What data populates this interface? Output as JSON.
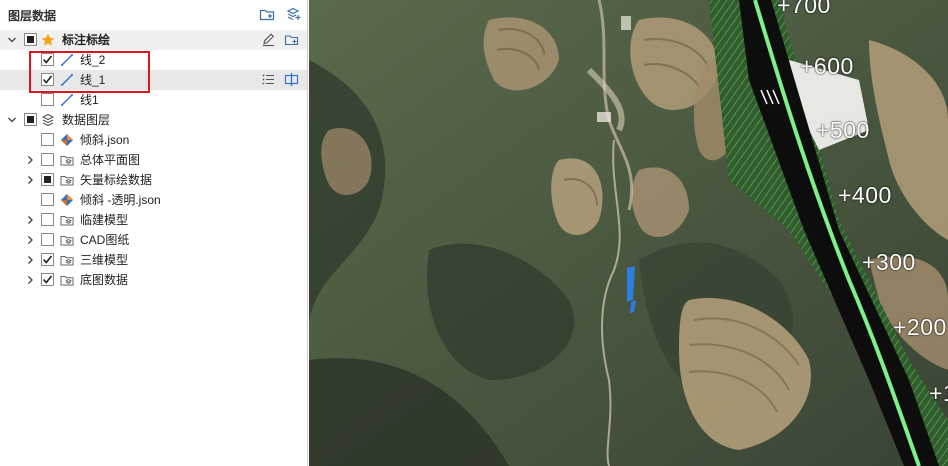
{
  "panel": {
    "title": "图层数据"
  },
  "layers": {
    "group_annotation": {
      "label": "标注标绘"
    },
    "line2": {
      "label": "线_2"
    },
    "line1_selected": {
      "label": "线_1"
    },
    "line1b": {
      "label": "线1"
    },
    "group_data": {
      "label": "数据图层"
    },
    "tilt_json": {
      "label": "倾斜.json"
    },
    "master_plan": {
      "label": "总体平面图"
    },
    "vector_plot": {
      "label": "矢量标绘数据"
    },
    "tilt_transparent": {
      "label": "倾斜 -透明.json"
    },
    "temp_model": {
      "label": "临建模型"
    },
    "cad_drawing": {
      "label": "CAD图纸"
    },
    "model_3d": {
      "label": "三维模型"
    },
    "basemap": {
      "label": "底图数据"
    }
  },
  "map": {
    "stations": [
      "+700",
      "+600",
      "+500",
      "+400",
      "+300",
      "+200",
      "+1"
    ]
  },
  "colors": {
    "accent": "#1e6fd9",
    "highlight_box": "#e0141e",
    "road_line": "#7ef08a",
    "road_verge": "#3f7a3a"
  }
}
